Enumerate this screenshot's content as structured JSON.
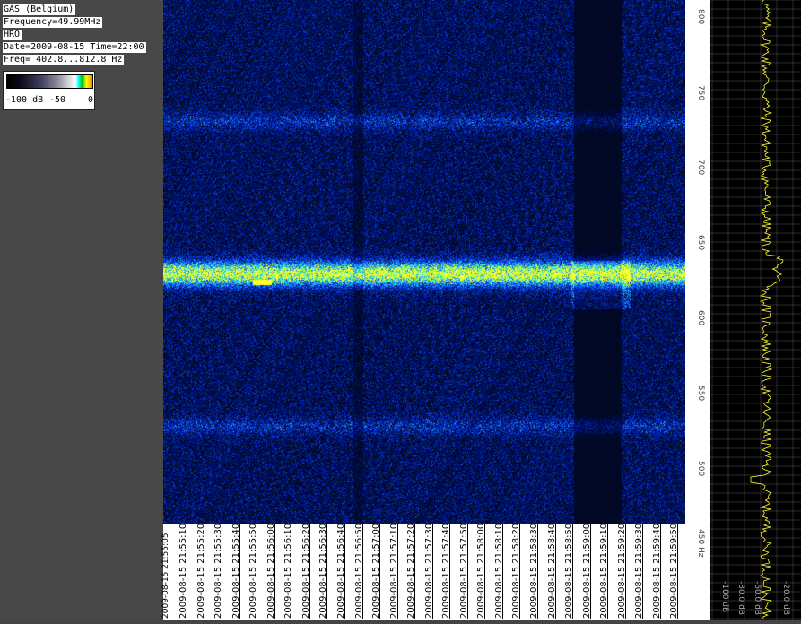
{
  "info": {
    "station": "GAS (Belgium)",
    "frequency": "Frequency=49.99MHz",
    "mode": "HRO",
    "datetime": "Date=2009-08-15 Time=22:00",
    "freq_range": "Freq= 402.8...812.8 Hz"
  },
  "legend": {
    "min_label": "-100 dB",
    "mid_label": "-50",
    "max_label": "0"
  },
  "freq_axis": {
    "labels": [
      "800",
      "750",
      "700",
      "650",
      "600",
      "550",
      "500",
      "450 Hz"
    ]
  },
  "time_axis": {
    "first_partial": "2009-08-15 21:55:05",
    "labels": [
      "2009-08-15 21:55:10",
      "2009-08-15 21:55:20",
      "2009-08-15 21:55:30",
      "2009-08-15 21:55:40",
      "2009-08-15 21:55:50",
      "2009-08-15 21:56:00",
      "2009-08-15 21:56:10",
      "2009-08-15 21:56:20",
      "2009-08-15 21:56:30",
      "2009-08-15 21:56:40",
      "2009-08-15 21:56:50",
      "2009-08-15 21:57:00",
      "2009-08-15 21:57:10",
      "2009-08-15 21:57:20",
      "2009-08-15 21:57:30",
      "2009-08-15 21:57:40",
      "2009-08-15 21:57:50",
      "2009-08-15 21:58:00",
      "2009-08-15 21:58:10",
      "2009-08-15 21:58:20",
      "2009-08-15 21:58:30",
      "2009-08-15 21:58:40",
      "2009-08-15 21:58:50",
      "2009-08-15 21:59:00",
      "2009-08-15 21:59:10",
      "2009-08-15 21:59:20",
      "2009-08-15 21:59:30",
      "2009-08-15 21:59:40",
      "2009-08-15 21:59:50"
    ]
  },
  "spectrum_axis": {
    "labels": [
      "-100 dB",
      "-80.0 dB",
      "-60.0 dB",
      "-20.0 dB"
    ]
  },
  "colors": {
    "panel_bg": "#484848",
    "waterfall_bg": "#000826",
    "trace": "#ffff33",
    "grid": "#555555"
  }
}
